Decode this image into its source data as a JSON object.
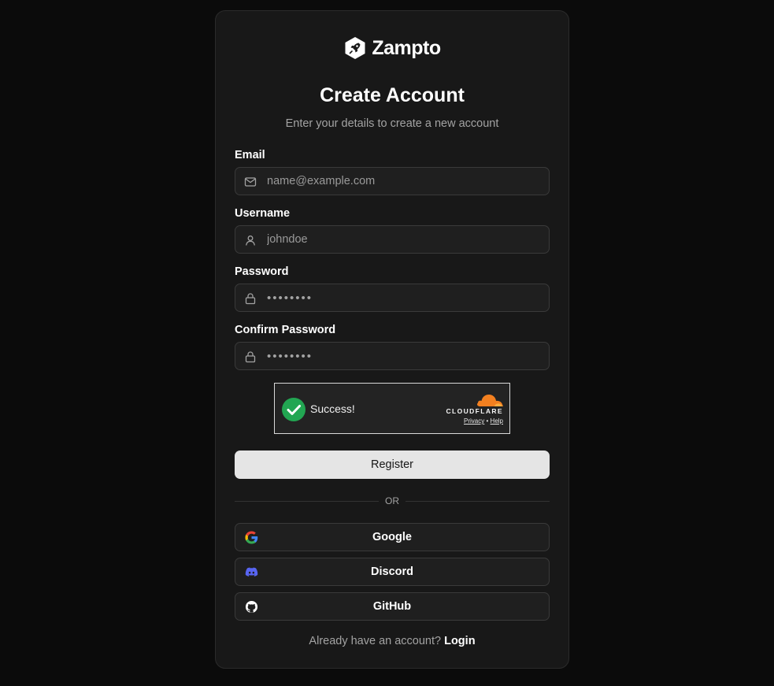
{
  "brand": {
    "name": "Zampto",
    "logo_icon": "rocket-hexagon-icon"
  },
  "header": {
    "title": "Create Account",
    "subtitle": "Enter your details to create a new account"
  },
  "form": {
    "email": {
      "label": "Email",
      "placeholder": "name@example.com",
      "value": "",
      "icon": "mail-icon"
    },
    "username": {
      "label": "Username",
      "placeholder": "johndoe",
      "value": "",
      "icon": "user-icon"
    },
    "password": {
      "label": "Password",
      "value": "••••••••",
      "icon": "lock-icon"
    },
    "confirm_password": {
      "label": "Confirm Password",
      "value": "••••••••",
      "icon": "lock-icon"
    }
  },
  "captcha": {
    "status": "Success!",
    "provider": "CLOUDFLARE",
    "privacy_label": "Privacy",
    "separator": "•",
    "help_label": "Help",
    "success_color": "#22a652",
    "brand_color": "#f38020"
  },
  "register_button": {
    "label": "Register"
  },
  "divider": {
    "label": "OR"
  },
  "social": [
    {
      "label": "Google",
      "icon": "google-icon"
    },
    {
      "label": "Discord",
      "icon": "discord-icon"
    },
    {
      "label": "GitHub",
      "icon": "github-icon"
    }
  ],
  "footer": {
    "prompt": "Already have an account?",
    "login_label": "Login"
  },
  "colors": {
    "background": "#0b0b0b",
    "card": "#181818",
    "input_bg": "#1f1f1f",
    "primary_button": "#e5e5e5",
    "discord": "#5865f2"
  }
}
